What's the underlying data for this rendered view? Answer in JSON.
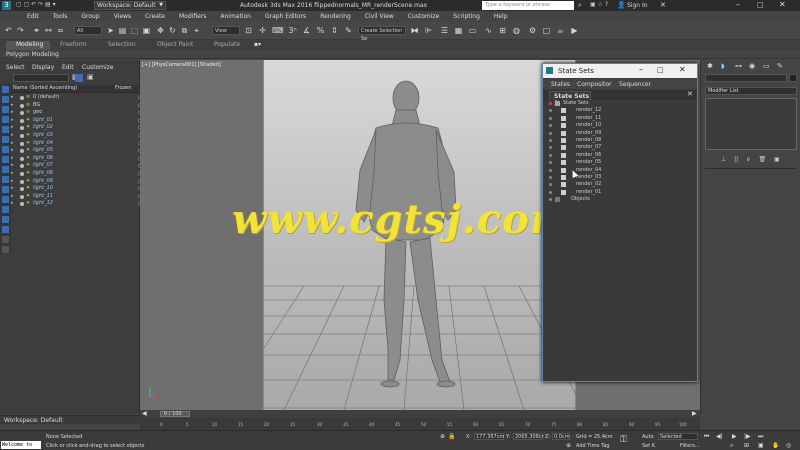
{
  "window": {
    "title": "Autodesk 3ds Max 2016    flippednormals_MR_renderScene.max",
    "workspace_label": "Workspace: Default",
    "search_placeholder": "Type a keyword or phrase",
    "sign_in": "Sign In"
  },
  "menu": [
    "Edit",
    "Tools",
    "Group",
    "Views",
    "Create",
    "Modifiers",
    "Animation",
    "Graph Editors",
    "Rendering",
    "Civil View",
    "Customize",
    "Scripting",
    "Help"
  ],
  "toolbar": {
    "selection_filter": "All",
    "ref_coord": "View",
    "named_selection": "Create Selection Se"
  },
  "ribbon": {
    "tabs": [
      "Modeling",
      "Freeform",
      "Selection",
      "Object Paint",
      "Populate"
    ],
    "sub_label": "Polygon Modeling"
  },
  "scene_explorer": {
    "menu": [
      "Select",
      "Display",
      "Edit",
      "Customize"
    ],
    "col_name": "Name (Sorted Ascending)",
    "col_frozen": "Frozen",
    "items": [
      "0 (default)",
      "BG",
      "geo",
      "light_01",
      "light_02",
      "light_03",
      "light_04",
      "light_05",
      "light_06",
      "light_07",
      "light_08",
      "light_09",
      "light_10",
      "light_11",
      "light_12"
    ],
    "workspace_footer": "Workspace: Default"
  },
  "viewport": {
    "label": "[+] [PhysCamera001] [Shaded]"
  },
  "state_sets": {
    "title": "State Sets",
    "menu": [
      "States",
      "Compositor",
      "Sequencer"
    ],
    "tab": "State Sets 1",
    "root": "State Sets",
    "items": [
      "render_12",
      "render_11",
      "render_10",
      "render_09",
      "render_08",
      "render_07",
      "render_06",
      "render_05",
      "render_04",
      "render_03",
      "render_02",
      "render_01"
    ],
    "objects": "Objects"
  },
  "command_panel": {
    "modifier_list": "Modifier List"
  },
  "timeline": {
    "frame_label": "0 / 100",
    "ticks": [
      "0",
      "5",
      "10",
      "15",
      "20",
      "25",
      "30",
      "35",
      "40",
      "45",
      "50",
      "55",
      "60",
      "65",
      "70",
      "75",
      "80",
      "85",
      "90",
      "95",
      "100"
    ]
  },
  "status": {
    "maxscript": "Welcome to",
    "selected": "None Selected",
    "prompt": "Click or click-and-drag to select objects",
    "x_label": "X:",
    "x_value": "177.367cm",
    "y_label": "Y:",
    "y_value": "2065.308cr",
    "z_label": "Z:",
    "z_value": "0.0cm",
    "grid": "Grid = 25.4cm",
    "add_time_tag": "Add Time Tag",
    "auto_key": "Auto",
    "set_key": "Set K.",
    "selected_dropdown": "Selected",
    "filters": "Filters..."
  },
  "watermark": "www.cgtsj.com",
  "colors": {
    "selection_blue": "#3a6fb5",
    "watermark_yellow": "#f2e23a",
    "window_border": "#5b84b1"
  }
}
